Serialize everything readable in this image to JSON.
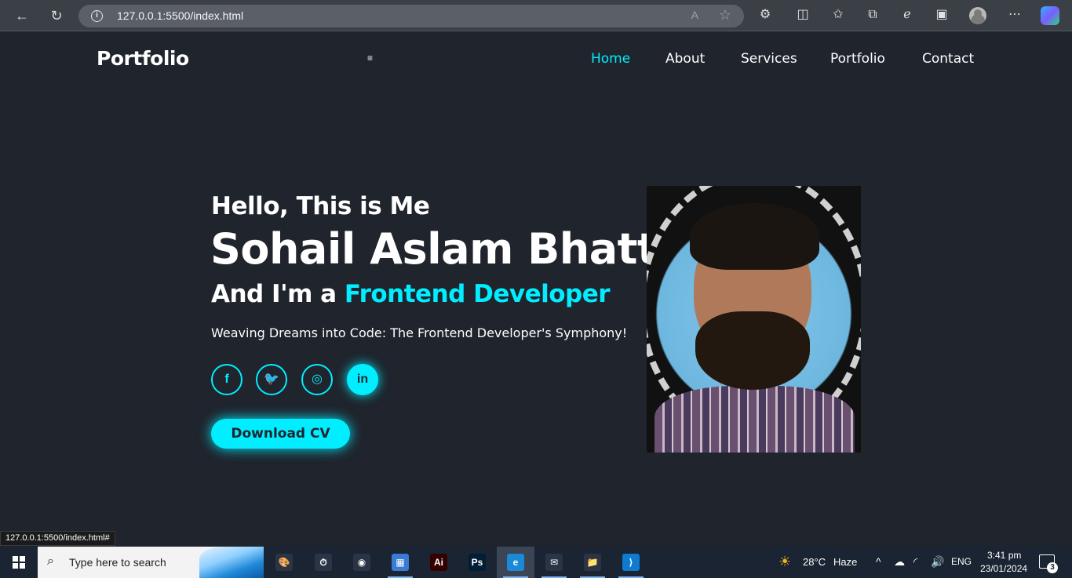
{
  "browser": {
    "url": "127.0.0.1:5500/index.html",
    "read_aloud_label": "A",
    "status_link": "127.0.0.1:5500/index.html#"
  },
  "header": {
    "logo": "Portfolio",
    "menu_toggle": "≡",
    "nav": [
      {
        "label": "Home",
        "active": true
      },
      {
        "label": "About",
        "active": false
      },
      {
        "label": "Services",
        "active": false
      },
      {
        "label": "Portfolio",
        "active": false
      },
      {
        "label": "Contact",
        "active": false
      }
    ]
  },
  "hero": {
    "greeting": "Hello, This is Me",
    "name": "Sohail Aslam Bhatti",
    "role_prefix": "And I'm a ",
    "role_highlight": "Frontend Developer",
    "tagline": "Weaving Dreams into Code: The Frontend Developer's Symphony!",
    "socials": [
      {
        "icon": "facebook-icon",
        "glyph": "f"
      },
      {
        "icon": "twitter-icon",
        "glyph": "🐦"
      },
      {
        "icon": "instagram-icon",
        "glyph": "◎"
      },
      {
        "icon": "linkedin-icon",
        "glyph": "in"
      }
    ],
    "cv_button": "Download CV",
    "accent_color": "#00eeff",
    "background_color": "#1f242d"
  },
  "taskbar": {
    "search_placeholder": "Type here to search",
    "weather_temp": "28°C",
    "weather_desc": "Haze",
    "language": "ENG",
    "time": "3:41 pm",
    "date": "23/01/2024",
    "notification_count": "3",
    "apps": [
      {
        "name": "paint-app-icon",
        "glyph": "🎨",
        "color": "#2a3444"
      },
      {
        "name": "clock-app-icon",
        "glyph": "⏱",
        "color": "#2a3444"
      },
      {
        "name": "obs-app-icon",
        "glyph": "◉",
        "color": "#2a3444"
      },
      {
        "name": "control-panel-icon",
        "glyph": "▦",
        "color": "#3a7bd5"
      },
      {
        "name": "illustrator-icon",
        "glyph": "Ai",
        "color": "#330000"
      },
      {
        "name": "photoshop-icon",
        "glyph": "Ps",
        "color": "#001e36"
      },
      {
        "name": "edge-icon",
        "glyph": "e",
        "color": "#1b8ad6"
      },
      {
        "name": "mail-icon",
        "glyph": "✉",
        "color": "#2a3444"
      },
      {
        "name": "file-explorer-icon",
        "glyph": "📁",
        "color": "#2a3444"
      },
      {
        "name": "vscode-icon",
        "glyph": "⟩",
        "color": "#0e7ad1"
      }
    ]
  }
}
